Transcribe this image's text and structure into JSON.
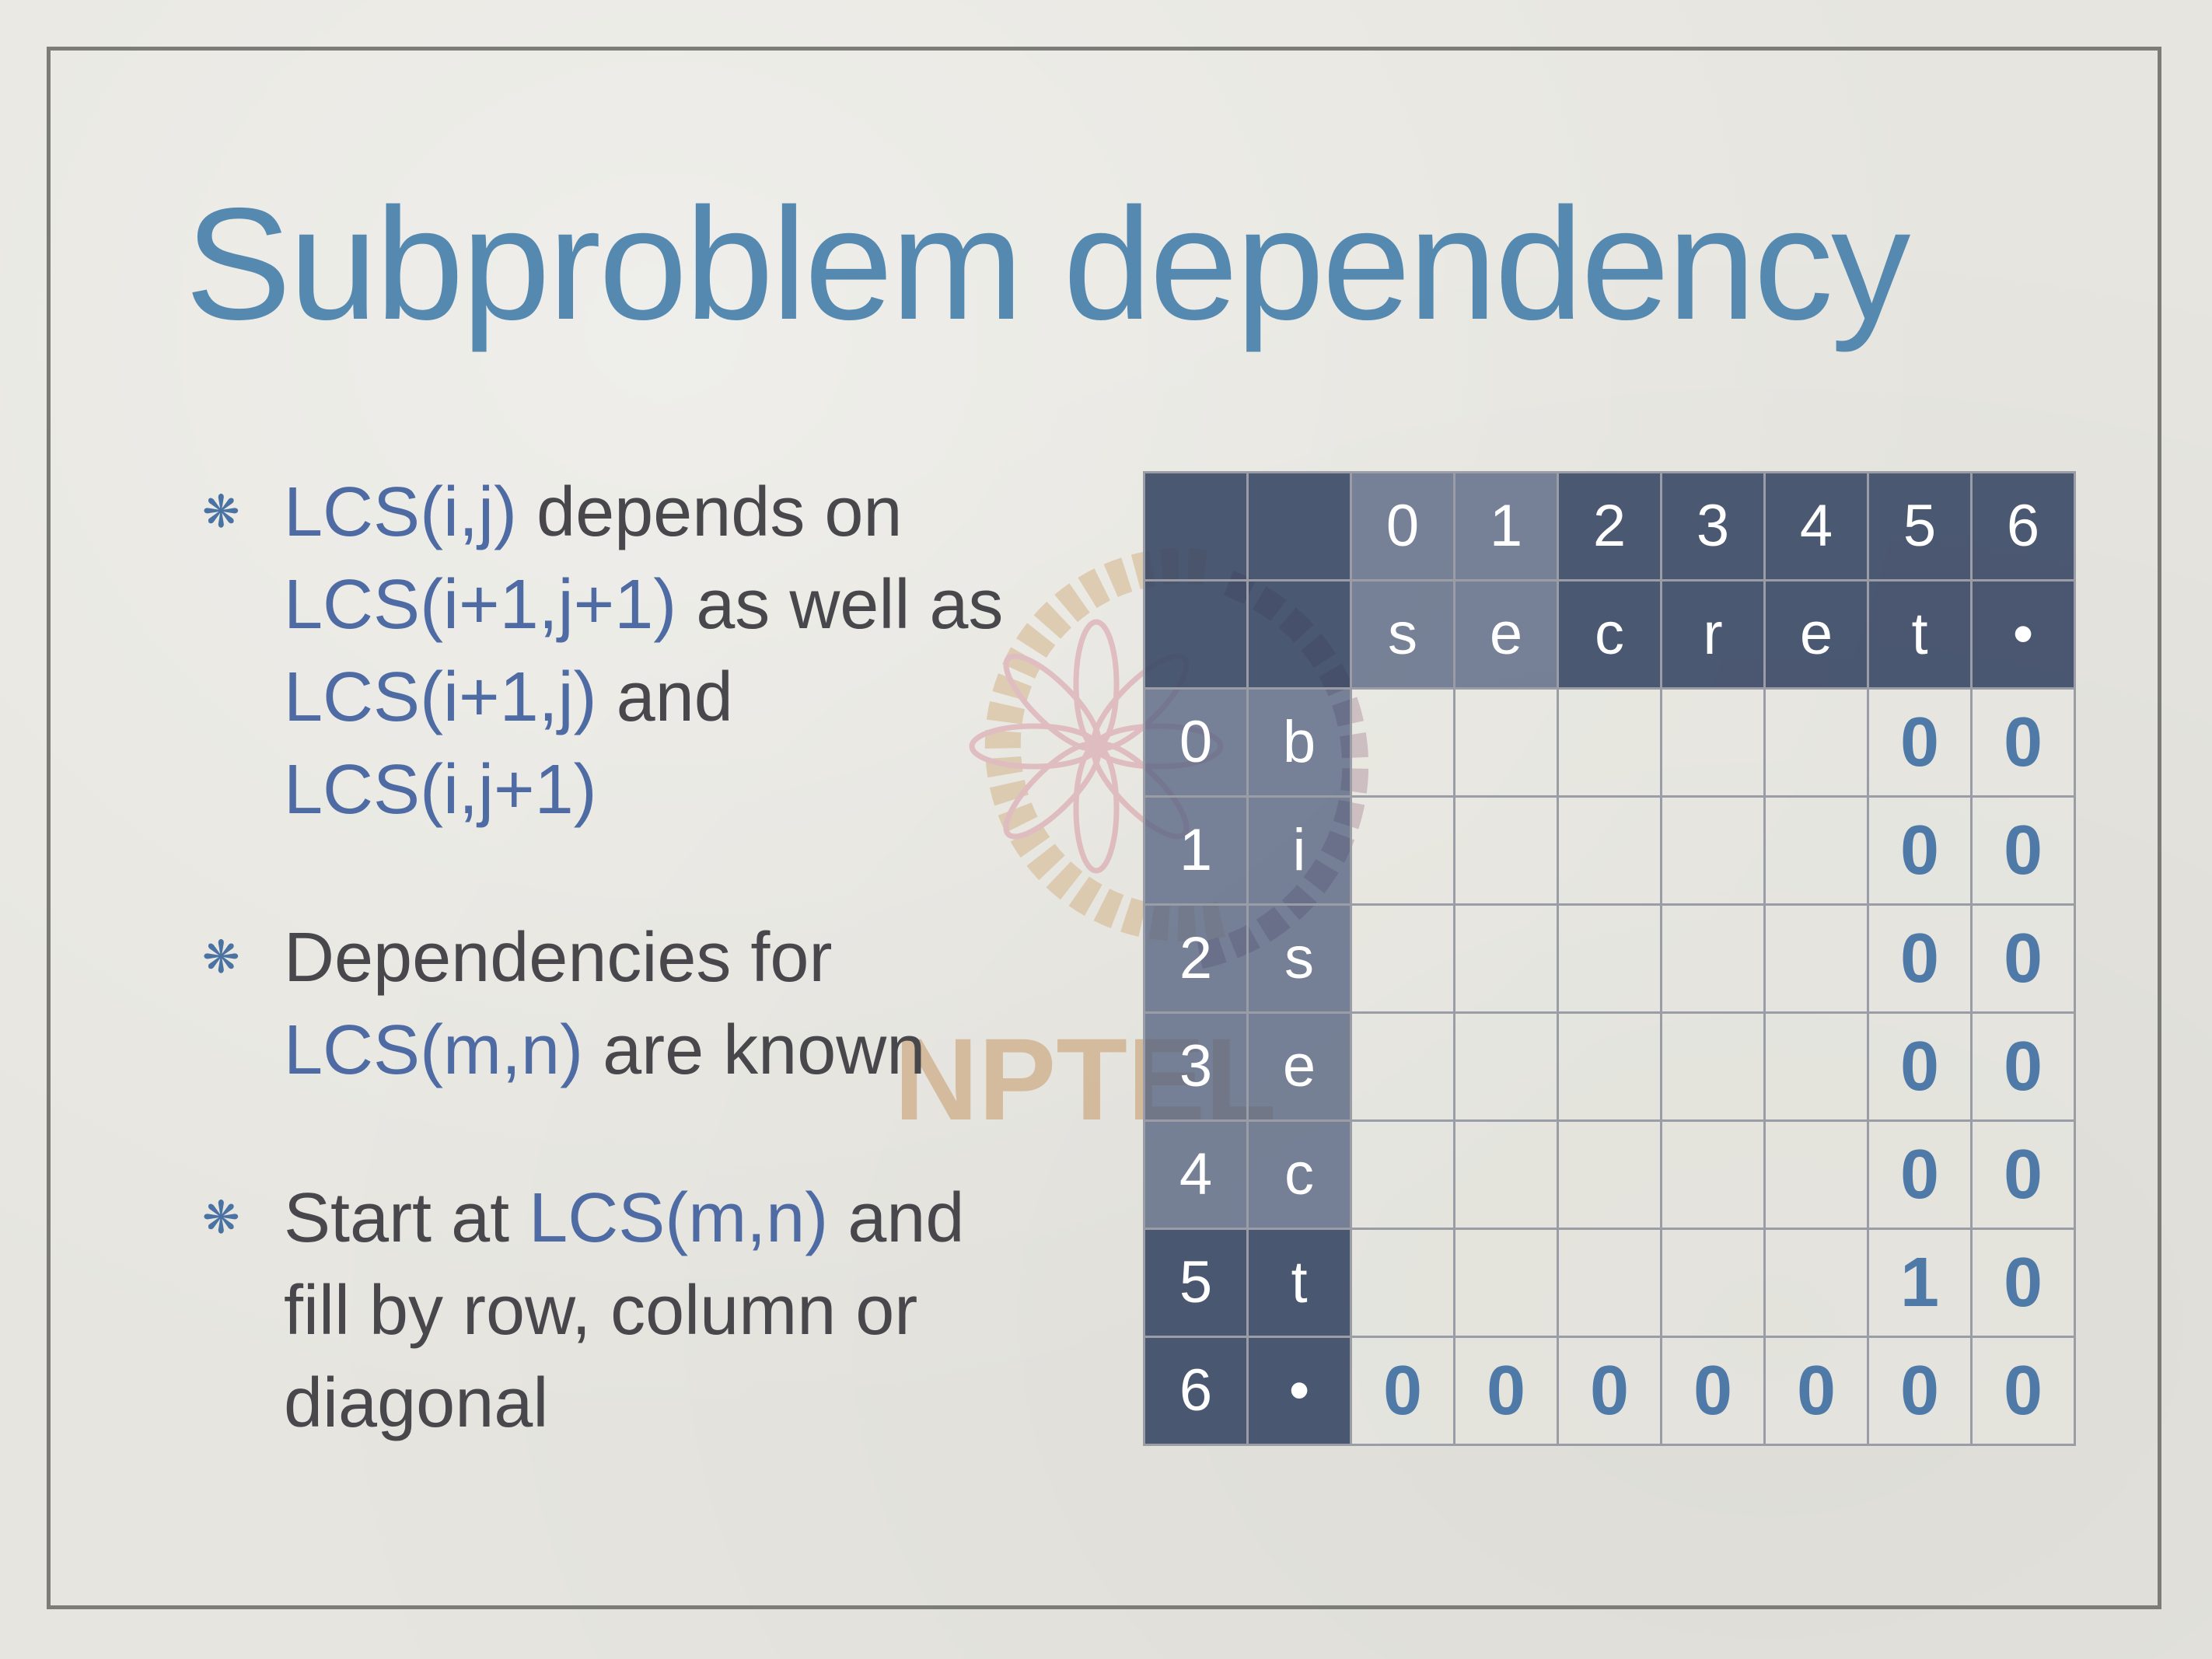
{
  "slide": {
    "title": "Subproblem dependency",
    "bullet_icon": "asterisk-icon",
    "watermark": "NPTEL",
    "bullets": [
      {
        "segments": [
          {
            "text": "LCS(i,j)",
            "hl": true
          },
          {
            "text": " depends on ",
            "hl": false
          },
          {
            "text": "LCS(i+1,j+1)",
            "hl": true
          },
          {
            "text": " as well as ",
            "hl": false
          },
          {
            "text": "LCS(i+1,j)",
            "hl": true
          },
          {
            "text": " and ",
            "hl": false
          },
          {
            "text": "LCS(i,j+1)",
            "hl": true
          }
        ]
      },
      {
        "segments": [
          {
            "text": "Dependencies for ",
            "hl": false
          },
          {
            "text": "LCS(m,n)",
            "hl": true
          },
          {
            "text": " are known",
            "hl": false
          }
        ]
      },
      {
        "segments": [
          {
            "text": "Start at ",
            "hl": false
          },
          {
            "text": "LCS(m,n)",
            "hl": true
          },
          {
            "text": " and fill by row, column or diagonal",
            "hl": false
          }
        ]
      }
    ]
  },
  "table": {
    "col_indices": [
      "0",
      "1",
      "2",
      "3",
      "4",
      "5",
      "6"
    ],
    "col_chars": [
      "s",
      "e",
      "c",
      "r",
      "e",
      "t",
      "•"
    ],
    "rows": [
      {
        "index": "0",
        "char": "b",
        "cells": [
          "",
          "",
          "",
          "",
          "",
          "0",
          "0"
        ]
      },
      {
        "index": "1",
        "char": "i",
        "cells": [
          "",
          "",
          "",
          "",
          "",
          "0",
          "0"
        ]
      },
      {
        "index": "2",
        "char": "s",
        "cells": [
          "",
          "",
          "",
          "",
          "",
          "0",
          "0"
        ]
      },
      {
        "index": "3",
        "char": "e",
        "cells": [
          "",
          "",
          "",
          "",
          "",
          "0",
          "0"
        ]
      },
      {
        "index": "4",
        "char": "c",
        "cells": [
          "",
          "",
          "",
          "",
          "",
          "0",
          "0"
        ]
      },
      {
        "index": "5",
        "char": "t",
        "cells": [
          "",
          "",
          "",
          "",
          "",
          "1",
          "0"
        ]
      },
      {
        "index": "6",
        "char": "•",
        "cells": [
          "0",
          "0",
          "0",
          "0",
          "0",
          "0",
          "0"
        ]
      }
    ]
  },
  "colors": {
    "title": "#5589b0",
    "body_text": "#48484c",
    "highlight_text": "#4f6ba3",
    "header_fill": "#3a4865",
    "value_text": "#4f7aa8",
    "background": "#e6e5df"
  }
}
